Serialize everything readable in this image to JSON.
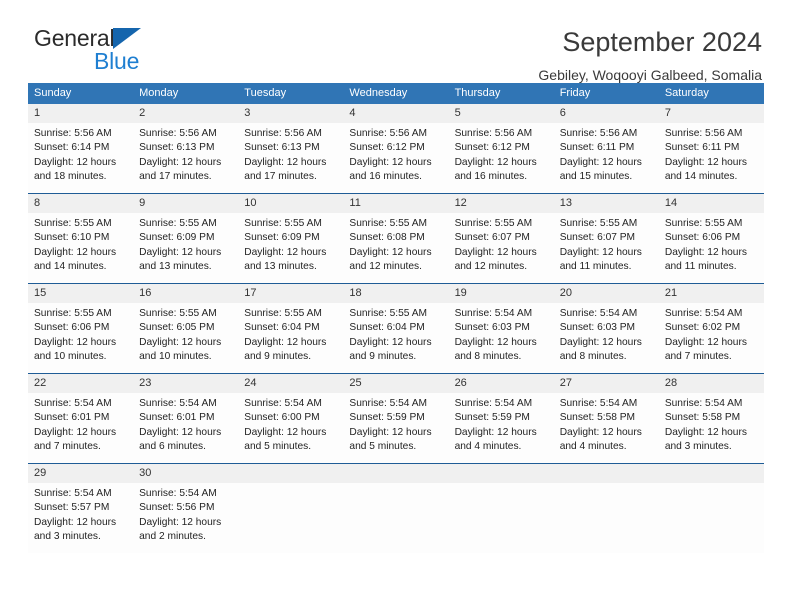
{
  "logo": {
    "word1": "General",
    "word2": "Blue",
    "triangle_color": "#1565ad",
    "word2_color": "#1f7fd1"
  },
  "header": {
    "title": "September 2024",
    "subtitle": "Gebiley, Woqooyi Galbeed, Somalia"
  },
  "theme": {
    "header_blue": "#3075b5",
    "row_border_blue": "#1f5c96",
    "day_band_gray": "#f0f0f0"
  },
  "weekdays": [
    "Sunday",
    "Monday",
    "Tuesday",
    "Wednesday",
    "Thursday",
    "Friday",
    "Saturday"
  ],
  "weeks": [
    [
      {
        "day": "1",
        "lines": [
          "Sunrise: 5:56 AM",
          "Sunset: 6:14 PM",
          "Daylight: 12 hours",
          "and 18 minutes."
        ]
      },
      {
        "day": "2",
        "lines": [
          "Sunrise: 5:56 AM",
          "Sunset: 6:13 PM",
          "Daylight: 12 hours",
          "and 17 minutes."
        ]
      },
      {
        "day": "3",
        "lines": [
          "Sunrise: 5:56 AM",
          "Sunset: 6:13 PM",
          "Daylight: 12 hours",
          "and 17 minutes."
        ]
      },
      {
        "day": "4",
        "lines": [
          "Sunrise: 5:56 AM",
          "Sunset: 6:12 PM",
          "Daylight: 12 hours",
          "and 16 minutes."
        ]
      },
      {
        "day": "5",
        "lines": [
          "Sunrise: 5:56 AM",
          "Sunset: 6:12 PM",
          "Daylight: 12 hours",
          "and 16 minutes."
        ]
      },
      {
        "day": "6",
        "lines": [
          "Sunrise: 5:56 AM",
          "Sunset: 6:11 PM",
          "Daylight: 12 hours",
          "and 15 minutes."
        ]
      },
      {
        "day": "7",
        "lines": [
          "Sunrise: 5:56 AM",
          "Sunset: 6:11 PM",
          "Daylight: 12 hours",
          "and 14 minutes."
        ]
      }
    ],
    [
      {
        "day": "8",
        "lines": [
          "Sunrise: 5:55 AM",
          "Sunset: 6:10 PM",
          "Daylight: 12 hours",
          "and 14 minutes."
        ]
      },
      {
        "day": "9",
        "lines": [
          "Sunrise: 5:55 AM",
          "Sunset: 6:09 PM",
          "Daylight: 12 hours",
          "and 13 minutes."
        ]
      },
      {
        "day": "10",
        "lines": [
          "Sunrise: 5:55 AM",
          "Sunset: 6:09 PM",
          "Daylight: 12 hours",
          "and 13 minutes."
        ]
      },
      {
        "day": "11",
        "lines": [
          "Sunrise: 5:55 AM",
          "Sunset: 6:08 PM",
          "Daylight: 12 hours",
          "and 12 minutes."
        ]
      },
      {
        "day": "12",
        "lines": [
          "Sunrise: 5:55 AM",
          "Sunset: 6:07 PM",
          "Daylight: 12 hours",
          "and 12 minutes."
        ]
      },
      {
        "day": "13",
        "lines": [
          "Sunrise: 5:55 AM",
          "Sunset: 6:07 PM",
          "Daylight: 12 hours",
          "and 11 minutes."
        ]
      },
      {
        "day": "14",
        "lines": [
          "Sunrise: 5:55 AM",
          "Sunset: 6:06 PM",
          "Daylight: 12 hours",
          "and 11 minutes."
        ]
      }
    ],
    [
      {
        "day": "15",
        "lines": [
          "Sunrise: 5:55 AM",
          "Sunset: 6:06 PM",
          "Daylight: 12 hours",
          "and 10 minutes."
        ]
      },
      {
        "day": "16",
        "lines": [
          "Sunrise: 5:55 AM",
          "Sunset: 6:05 PM",
          "Daylight: 12 hours",
          "and 10 minutes."
        ]
      },
      {
        "day": "17",
        "lines": [
          "Sunrise: 5:55 AM",
          "Sunset: 6:04 PM",
          "Daylight: 12 hours",
          "and 9 minutes."
        ]
      },
      {
        "day": "18",
        "lines": [
          "Sunrise: 5:55 AM",
          "Sunset: 6:04 PM",
          "Daylight: 12 hours",
          "and 9 minutes."
        ]
      },
      {
        "day": "19",
        "lines": [
          "Sunrise: 5:54 AM",
          "Sunset: 6:03 PM",
          "Daylight: 12 hours",
          "and 8 minutes."
        ]
      },
      {
        "day": "20",
        "lines": [
          "Sunrise: 5:54 AM",
          "Sunset: 6:03 PM",
          "Daylight: 12 hours",
          "and 8 minutes."
        ]
      },
      {
        "day": "21",
        "lines": [
          "Sunrise: 5:54 AM",
          "Sunset: 6:02 PM",
          "Daylight: 12 hours",
          "and 7 minutes."
        ]
      }
    ],
    [
      {
        "day": "22",
        "lines": [
          "Sunrise: 5:54 AM",
          "Sunset: 6:01 PM",
          "Daylight: 12 hours",
          "and 7 minutes."
        ]
      },
      {
        "day": "23",
        "lines": [
          "Sunrise: 5:54 AM",
          "Sunset: 6:01 PM",
          "Daylight: 12 hours",
          "and 6 minutes."
        ]
      },
      {
        "day": "24",
        "lines": [
          "Sunrise: 5:54 AM",
          "Sunset: 6:00 PM",
          "Daylight: 12 hours",
          "and 5 minutes."
        ]
      },
      {
        "day": "25",
        "lines": [
          "Sunrise: 5:54 AM",
          "Sunset: 5:59 PM",
          "Daylight: 12 hours",
          "and 5 minutes."
        ]
      },
      {
        "day": "26",
        "lines": [
          "Sunrise: 5:54 AM",
          "Sunset: 5:59 PM",
          "Daylight: 12 hours",
          "and 4 minutes."
        ]
      },
      {
        "day": "27",
        "lines": [
          "Sunrise: 5:54 AM",
          "Sunset: 5:58 PM",
          "Daylight: 12 hours",
          "and 4 minutes."
        ]
      },
      {
        "day": "28",
        "lines": [
          "Sunrise: 5:54 AM",
          "Sunset: 5:58 PM",
          "Daylight: 12 hours",
          "and 3 minutes."
        ]
      }
    ],
    [
      {
        "day": "29",
        "lines": [
          "Sunrise: 5:54 AM",
          "Sunset: 5:57 PM",
          "Daylight: 12 hours",
          "and 3 minutes."
        ]
      },
      {
        "day": "30",
        "lines": [
          "Sunrise: 5:54 AM",
          "Sunset: 5:56 PM",
          "Daylight: 12 hours",
          "and 2 minutes."
        ]
      },
      {
        "day": "",
        "lines": []
      },
      {
        "day": "",
        "lines": []
      },
      {
        "day": "",
        "lines": []
      },
      {
        "day": "",
        "lines": []
      },
      {
        "day": "",
        "lines": []
      }
    ]
  ]
}
